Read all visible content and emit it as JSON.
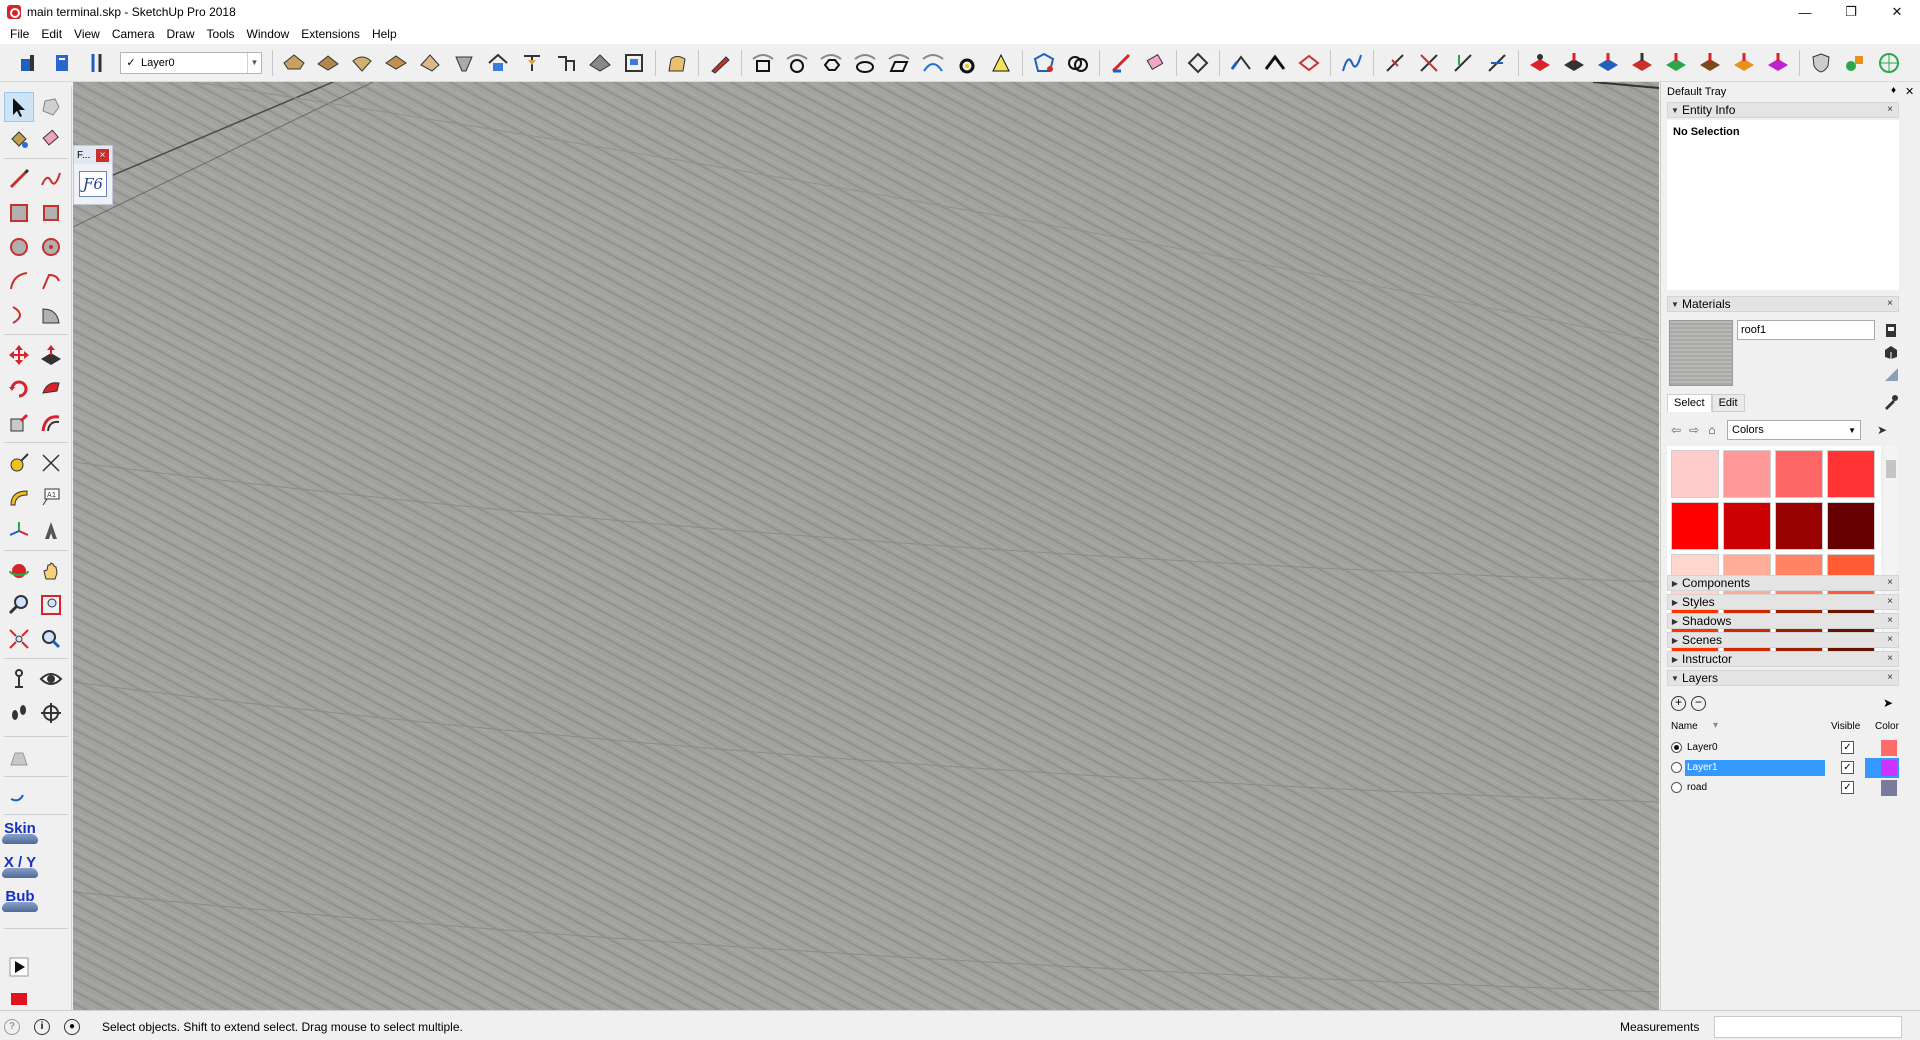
{
  "window": {
    "title": "main terminal.skp - SketchUp Pro 2018"
  },
  "menu": [
    "File",
    "Edit",
    "View",
    "Camera",
    "Draw",
    "Tools",
    "Window",
    "Extensions",
    "Help"
  ],
  "toolbar": {
    "layer_value": "Layer0"
  },
  "floating_toolbar": {
    "title": "F...",
    "icon_glyph": "Ƒ6"
  },
  "left_tools": {
    "skin": "Skin",
    "xy": "X / Y",
    "bub": "Bub"
  },
  "tray": {
    "title": "Default Tray",
    "entity_info": {
      "title": "Entity Info",
      "value": "No Selection"
    },
    "materials": {
      "title": "Materials",
      "name": "roof1",
      "tab_select": "Select",
      "tab_edit": "Edit",
      "library": "Colors",
      "swatches": [
        "#ffcccc",
        "#ff9999",
        "#ff6666",
        "#ff3333",
        "#ff0000",
        "#cc0000",
        "#990000",
        "#660000",
        "#ffd5cc",
        "#ffad99",
        "#ff8566",
        "#ff5c33",
        "#ff3300",
        "#cc2900",
        "#991f00",
        "#661400",
        "#ffe6cc",
        "#ffcc99",
        "#ffb366",
        "#ff9933",
        "#ff8000",
        "#cc6600",
        "#994d00",
        "#663300"
      ]
    },
    "collapsed_panels": [
      "Components",
      "Styles",
      "Shadows",
      "Scenes",
      "Instructor"
    ],
    "layers": {
      "title": "Layers",
      "col_name": "Name",
      "col_visible": "Visible",
      "col_color": "Color",
      "rows": [
        {
          "name": "Layer0",
          "active": true,
          "selected": false,
          "color": "#ff6a6a"
        },
        {
          "name": "Layer1",
          "active": false,
          "selected": true,
          "color": "#cc33ff"
        },
        {
          "name": "road",
          "active": false,
          "selected": false,
          "color": "#7a7a9a"
        }
      ]
    }
  },
  "status": {
    "text": "Select objects. Shift to extend select. Drag mouse to select multiple.",
    "measurements_label": "Measurements"
  }
}
